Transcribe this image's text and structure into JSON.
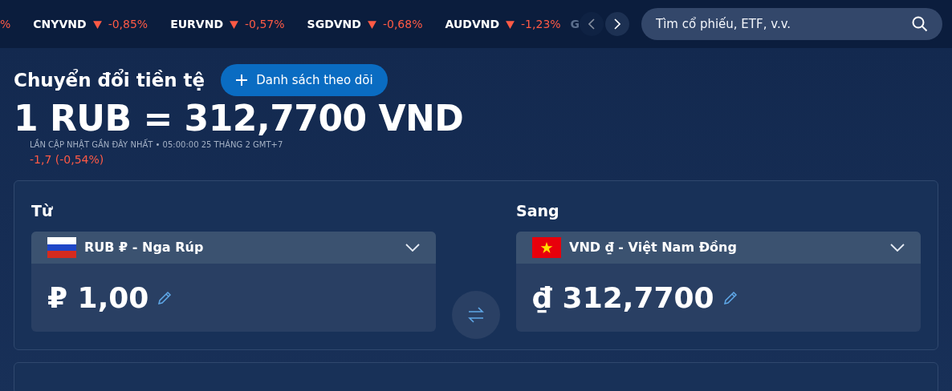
{
  "ticker": {
    "leading_fragment": "%",
    "items": [
      {
        "symbol": "CNYVND",
        "kind": "down",
        "change": "-0,85%"
      },
      {
        "symbol": "EURVND",
        "kind": "down",
        "change": "-0,57%"
      },
      {
        "symbol": "SGDVND",
        "kind": "down",
        "change": "-0,68%"
      },
      {
        "symbol": "AUDVND",
        "kind": "down",
        "change": "-1,23%"
      }
    ],
    "trailing_fragment": "G",
    "prev_disabled": true
  },
  "search": {
    "placeholder": "Tìm cổ phiếu, ETF, v.v."
  },
  "header": {
    "title": "Chuyển đổi tiền tệ",
    "watchlist_button": "Danh sách theo dõi"
  },
  "rate": {
    "text": "1 RUB = 312,7700 VND",
    "updated": "LẦN CẬP NHẬT GẦN ĐÂY NHẤT • 05:00:00 25 THÁNG 2 GMT+7",
    "change": "-1,7 (-0,54%)",
    "kind": "down"
  },
  "converter": {
    "from": {
      "label": "Từ",
      "kind": "ru",
      "currency": "RUB ₽ - Nga Rúp",
      "symbol": "₽",
      "amount": "1,00"
    },
    "to": {
      "label": "Sang",
      "kind": "vn",
      "currency": "VND ₫ - Việt Nam Đồng",
      "symbol": "₫",
      "amount": "312,7700"
    }
  }
}
